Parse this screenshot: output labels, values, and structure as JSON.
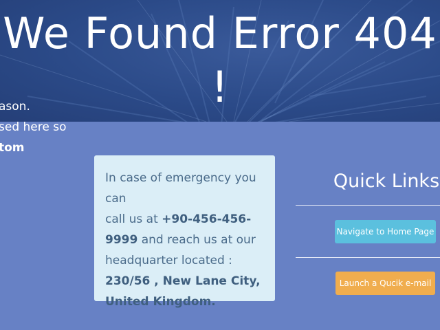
{
  "hero": {
    "title": "We Found Error 404 !"
  },
  "left_fragment": {
    "line1": "ason.",
    "line2": "sed here so",
    "line3": "tom"
  },
  "emergency_card": {
    "line1": "In case of emergency you can",
    "line2_prefix": "call us at ",
    "phone_part1": "+90-456-456-",
    "phone_part2": "9999",
    "line3_suffix": " and reach us at our",
    "line4": "headquarter located :",
    "address_line1": "230/56 , New Lane City,",
    "address_line2": "United Kingdom."
  },
  "quick_links": {
    "title": "Quick Links",
    "home_button": "Navigate to Home Page",
    "email_button": "Launch a Qucik e-mail"
  },
  "colors": {
    "hero_bg": "#2b4a88",
    "content_bg": "#6781c5",
    "card_bg": "#dbeef7",
    "home_button": "#5bc0de",
    "email_button": "#f0ad4e"
  }
}
